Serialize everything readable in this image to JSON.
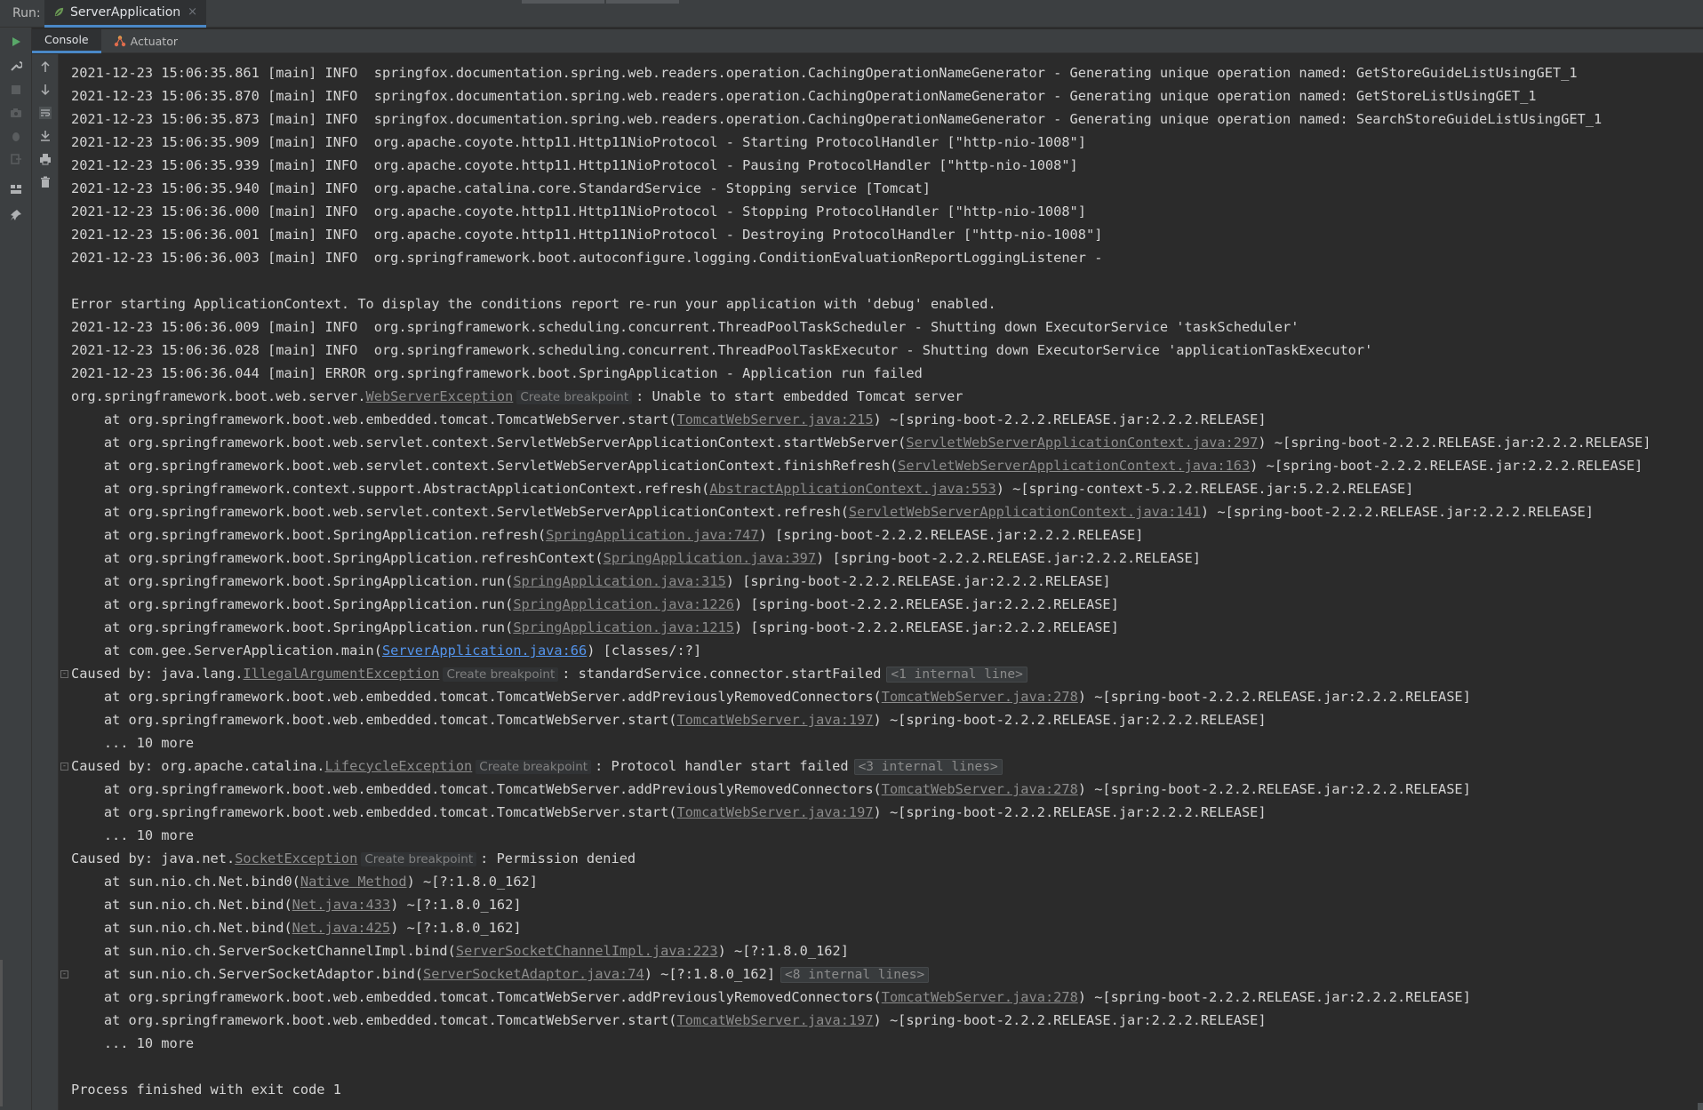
{
  "topbar": {
    "run_label": "Run:",
    "tab_title": "ServerApplication",
    "close_glyph": "×"
  },
  "subtabs": {
    "console": "Console",
    "actuator": "Actuator"
  },
  "icons": {
    "run": "play-icon",
    "accent": "#4a88c7",
    "link_color": "#8c8c8c",
    "active_link_color": "#5394ec"
  },
  "log": [
    {
      "text": "2021-12-23 15:06:35.861 [main] INFO  springfox.documentation.spring.web.readers.operation.CachingOperationNameGenerator - Generating unique operation named: GetStoreGuideListUsingGET_1"
    },
    {
      "text": "2021-12-23 15:06:35.870 [main] INFO  springfox.documentation.spring.web.readers.operation.CachingOperationNameGenerator - Generating unique operation named: GetStoreListUsingGET_1"
    },
    {
      "text": "2021-12-23 15:06:35.873 [main] INFO  springfox.documentation.spring.web.readers.operation.CachingOperationNameGenerator - Generating unique operation named: SearchStoreGuideListUsingGET_1"
    },
    {
      "text": "2021-12-23 15:06:35.909 [main] INFO  org.apache.coyote.http11.Http11NioProtocol - Starting ProtocolHandler [\"http-nio-1008\"]"
    },
    {
      "text": "2021-12-23 15:06:35.939 [main] INFO  org.apache.coyote.http11.Http11NioProtocol - Pausing ProtocolHandler [\"http-nio-1008\"]"
    },
    {
      "text": "2021-12-23 15:06:35.940 [main] INFO  org.apache.catalina.core.StandardService - Stopping service [Tomcat]"
    },
    {
      "text": "2021-12-23 15:06:36.000 [main] INFO  org.apache.coyote.http11.Http11NioProtocol - Stopping ProtocolHandler [\"http-nio-1008\"]"
    },
    {
      "text": "2021-12-23 15:06:36.001 [main] INFO  org.apache.coyote.http11.Http11NioProtocol - Destroying ProtocolHandler [\"http-nio-1008\"]"
    },
    {
      "text": "2021-12-23 15:06:36.003 [main] INFO  org.springframework.boot.autoconfigure.logging.ConditionEvaluationReportLoggingListener -"
    },
    {
      "text": ""
    },
    {
      "text": "Error starting ApplicationContext. To display the conditions report re-run your application with 'debug' enabled."
    },
    {
      "text": "2021-12-23 15:06:36.009 [main] INFO  org.springframework.scheduling.concurrent.ThreadPoolTaskScheduler - Shutting down ExecutorService 'taskScheduler'"
    },
    {
      "text": "2021-12-23 15:06:36.028 [main] INFO  org.springframework.scheduling.concurrent.ThreadPoolTaskExecutor - Shutting down ExecutorService 'applicationTaskExecutor'"
    },
    {
      "text": "2021-12-23 15:06:36.044 [main] ERROR org.springframework.boot.SpringApplication - Application run failed"
    },
    {
      "pre": "org.springframework.boot.web.server.",
      "link": "WebServerException",
      "bp": "Create breakpoint",
      "post": ": Unable to start embedded Tomcat server"
    },
    {
      "pre": "    at org.springframework.boot.web.embedded.tomcat.TomcatWebServer.start(",
      "link": "TomcatWebServer.java:215",
      "post": ") ~[spring-boot-2.2.2.RELEASE.jar:2.2.2.RELEASE]"
    },
    {
      "pre": "    at org.springframework.boot.web.servlet.context.ServletWebServerApplicationContext.startWebServer(",
      "link": "ServletWebServerApplicationContext.java:297",
      "post": ") ~[spring-boot-2.2.2.RELEASE.jar:2.2.2.RELEASE]"
    },
    {
      "pre": "    at org.springframework.boot.web.servlet.context.ServletWebServerApplicationContext.finishRefresh(",
      "link": "ServletWebServerApplicationContext.java:163",
      "post": ") ~[spring-boot-2.2.2.RELEASE.jar:2.2.2.RELEASE]"
    },
    {
      "pre": "    at org.springframework.context.support.AbstractApplicationContext.refresh(",
      "link": "AbstractApplicationContext.java:553",
      "post": ") ~[spring-context-5.2.2.RELEASE.jar:5.2.2.RELEASE]"
    },
    {
      "pre": "    at org.springframework.boot.web.servlet.context.ServletWebServerApplicationContext.refresh(",
      "link": "ServletWebServerApplicationContext.java:141",
      "post": ") ~[spring-boot-2.2.2.RELEASE.jar:2.2.2.RELEASE]"
    },
    {
      "pre": "    at org.springframework.boot.SpringApplication.refresh(",
      "link": "SpringApplication.java:747",
      "post": ") [spring-boot-2.2.2.RELEASE.jar:2.2.2.RELEASE]"
    },
    {
      "pre": "    at org.springframework.boot.SpringApplication.refreshContext(",
      "link": "SpringApplication.java:397",
      "post": ") [spring-boot-2.2.2.RELEASE.jar:2.2.2.RELEASE]"
    },
    {
      "pre": "    at org.springframework.boot.SpringApplication.run(",
      "link": "SpringApplication.java:315",
      "post": ") [spring-boot-2.2.2.RELEASE.jar:2.2.2.RELEASE]"
    },
    {
      "pre": "    at org.springframework.boot.SpringApplication.run(",
      "link": "SpringApplication.java:1226",
      "post": ") [spring-boot-2.2.2.RELEASE.jar:2.2.2.RELEASE]"
    },
    {
      "pre": "    at org.springframework.boot.SpringApplication.run(",
      "link": "SpringApplication.java:1215",
      "post": ") [spring-boot-2.2.2.RELEASE.jar:2.2.2.RELEASE]"
    },
    {
      "pre": "    at com.gee.ServerApplication.main(",
      "link": "ServerApplication.java:66",
      "blue": true,
      "post": ") [classes/:?]"
    },
    {
      "fold": true,
      "pre": "Caused by: java.lang.",
      "link": "IllegalArgumentException",
      "bp": "Create breakpoint",
      "post": ": standardService.connector.startFailed",
      "internal": "<1 internal line>"
    },
    {
      "pre": "    at org.springframework.boot.web.embedded.tomcat.TomcatWebServer.addPreviouslyRemovedConnectors(",
      "link": "TomcatWebServer.java:278",
      "post": ") ~[spring-boot-2.2.2.RELEASE.jar:2.2.2.RELEASE]"
    },
    {
      "pre": "    at org.springframework.boot.web.embedded.tomcat.TomcatWebServer.start(",
      "link": "TomcatWebServer.java:197",
      "post": ") ~[spring-boot-2.2.2.RELEASE.jar:2.2.2.RELEASE]"
    },
    {
      "text": "    ... 10 more"
    },
    {
      "fold": true,
      "pre": "Caused by: org.apache.catalina.",
      "link": "LifecycleException",
      "bp": "Create breakpoint",
      "post": ": Protocol handler start failed",
      "internal": "<3 internal lines>"
    },
    {
      "pre": "    at org.springframework.boot.web.embedded.tomcat.TomcatWebServer.addPreviouslyRemovedConnectors(",
      "link": "TomcatWebServer.java:278",
      "post": ") ~[spring-boot-2.2.2.RELEASE.jar:2.2.2.RELEASE]"
    },
    {
      "pre": "    at org.springframework.boot.web.embedded.tomcat.TomcatWebServer.start(",
      "link": "TomcatWebServer.java:197",
      "post": ") ~[spring-boot-2.2.2.RELEASE.jar:2.2.2.RELEASE]"
    },
    {
      "text": "    ... 10 more"
    },
    {
      "pre": "Caused by: java.net.",
      "link": "SocketException",
      "bp": "Create breakpoint",
      "post": ": Permission denied"
    },
    {
      "pre": "    at sun.nio.ch.Net.bind0(",
      "link": "Native Method",
      "post": ") ~[?:1.8.0_162]"
    },
    {
      "pre": "    at sun.nio.ch.Net.bind(",
      "link": "Net.java:433",
      "post": ") ~[?:1.8.0_162]"
    },
    {
      "pre": "    at sun.nio.ch.Net.bind(",
      "link": "Net.java:425",
      "post": ") ~[?:1.8.0_162]"
    },
    {
      "pre": "    at sun.nio.ch.ServerSocketChannelImpl.bind(",
      "link": "ServerSocketChannelImpl.java:223",
      "post": ") ~[?:1.8.0_162]"
    },
    {
      "fold": true,
      "pre": "    at sun.nio.ch.ServerSocketAdaptor.bind(",
      "link": "ServerSocketAdaptor.java:74",
      "post": ") ~[?:1.8.0_162]",
      "internal": "<8 internal lines>"
    },
    {
      "pre": "    at org.springframework.boot.web.embedded.tomcat.TomcatWebServer.addPreviouslyRemovedConnectors(",
      "link": "TomcatWebServer.java:278",
      "post": ") ~[spring-boot-2.2.2.RELEASE.jar:2.2.2.RELEASE]"
    },
    {
      "pre": "    at org.springframework.boot.web.embedded.tomcat.TomcatWebServer.start(",
      "link": "TomcatWebServer.java:197",
      "post": ") ~[spring-boot-2.2.2.RELEASE.jar:2.2.2.RELEASE]"
    },
    {
      "text": "    ... 10 more"
    },
    {
      "text": ""
    },
    {
      "text": "Process finished with exit code 1"
    }
  ]
}
